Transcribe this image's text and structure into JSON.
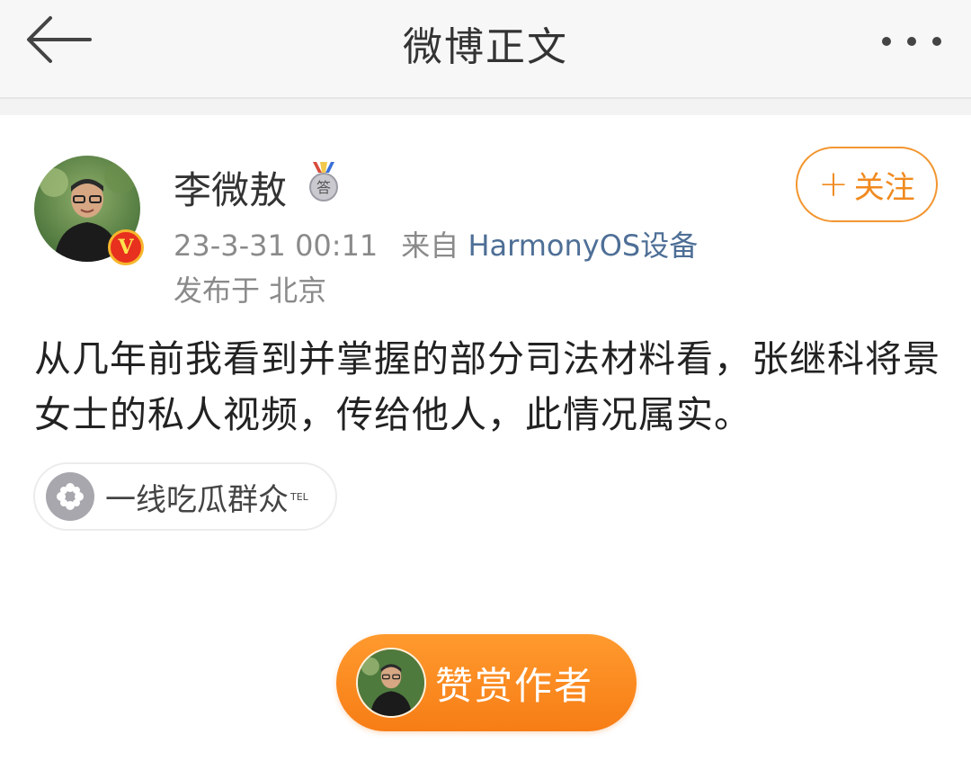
{
  "header": {
    "title": "微博正文",
    "back_icon": "back-arrow-icon",
    "more_icon": "more-dots-icon"
  },
  "post": {
    "author": {
      "name": "李微敖",
      "verified_badge": "V",
      "medal_label": "答",
      "avatar": "avatar-photo"
    },
    "follow_button": {
      "plus": "+",
      "label": "关注"
    },
    "meta": {
      "time": "23-3-31 00:11",
      "source_prefix": "来自",
      "source": "HarmonyOS设备",
      "location": "发布于 北京"
    },
    "content": "从几年前我看到并掌握的部分司法材料看，张继科将景女士的私人视频，传给他人，此情况属实。",
    "tag": {
      "label": "一线吃瓜群众",
      "sup": "TEL",
      "icon": "flower-icon"
    }
  },
  "reward": {
    "label": "赞赏作者"
  },
  "colors": {
    "accent_orange": "#f29630",
    "link_blue": "#4e6f96",
    "meta_gray": "#8a8a8a",
    "reward_orange": "#f77d16",
    "verified_red": "#e8301e"
  }
}
